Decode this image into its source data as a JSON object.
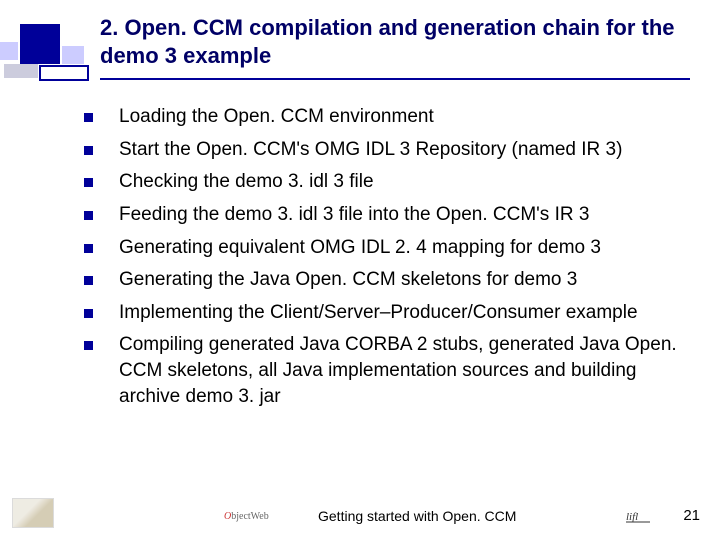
{
  "title": "2. Open. CCM compilation and generation chain for the demo 3 example",
  "bullets": {
    "b0": "Loading the Open. CCM environment",
    "b1": "Start the Open. CCM's OMG IDL 3 Repository (named IR 3)",
    "b2": "Checking the demo 3. idl 3 file",
    "b3": "Feeding the demo 3. idl 3 file into the Open. CCM's IR 3",
    "b4": "Generating equivalent OMG IDL 2. 4 mapping for demo 3",
    "b5": "Generating the Java Open. CCM skeletons for demo 3",
    "b6": "Implementing the Client/Server–Producer/Consumer example",
    "b7": "Compiling generated Java CORBA 2 stubs, generated Java Open. CCM skeletons, all Java implementation sources and building archive demo 3. jar"
  },
  "footer": {
    "center_text": "Getting started with Open. CCM",
    "page_number": "21",
    "center_logo_text": "bjectWeb"
  },
  "colors": {
    "accent": "#000099",
    "title": "#000066"
  }
}
